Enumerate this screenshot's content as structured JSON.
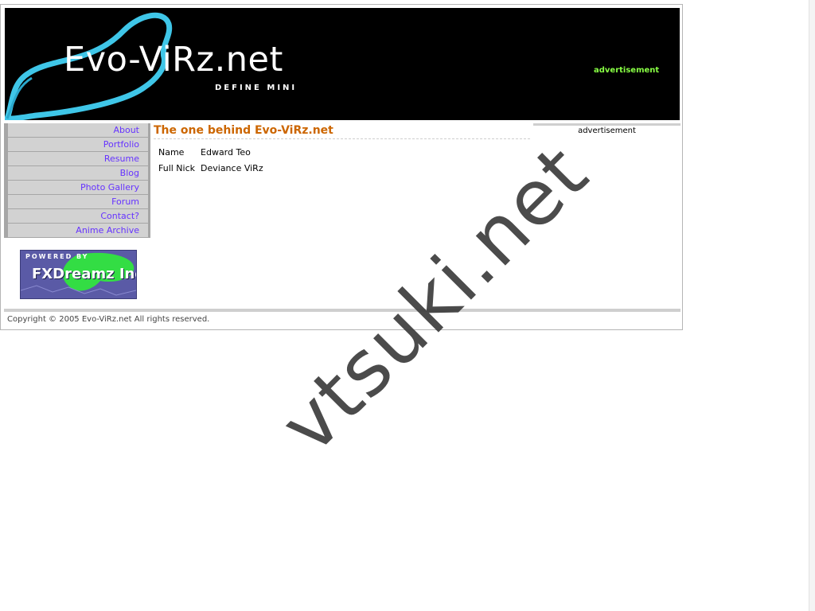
{
  "header": {
    "site_title": "Evo-ViRz.net",
    "tagline": "DEFINE MINI",
    "advertisement_label": "advertisement"
  },
  "nav": {
    "items": [
      {
        "label": "About"
      },
      {
        "label": "Portfolio"
      },
      {
        "label": "Resume"
      },
      {
        "label": "Blog"
      },
      {
        "label": "Photo Gallery"
      },
      {
        "label": "Forum"
      },
      {
        "label": "Contact?"
      },
      {
        "label": "Anime Archive"
      }
    ]
  },
  "badge": {
    "powered_by": "POWERED BY",
    "brand": "FXDreamz Inc."
  },
  "main": {
    "title": "The one behind Evo-ViRz.net",
    "profile": [
      {
        "label": "Name",
        "value": "Edward Teo"
      },
      {
        "label": "Full Nick",
        "value": "Deviance ViRz"
      }
    ]
  },
  "sidebar": {
    "advertisement_label": "advertisement"
  },
  "footer": {
    "copyright": "Copyright © 2005 Evo-ViRz.net All rights reserved."
  },
  "watermark": {
    "text": "vtsuki.net"
  },
  "colors": {
    "link": "#6633ff",
    "title": "#cc6600",
    "header_bg": "#000000",
    "header_ad": "#88ff44",
    "swoosh": "#3fc6e8"
  }
}
